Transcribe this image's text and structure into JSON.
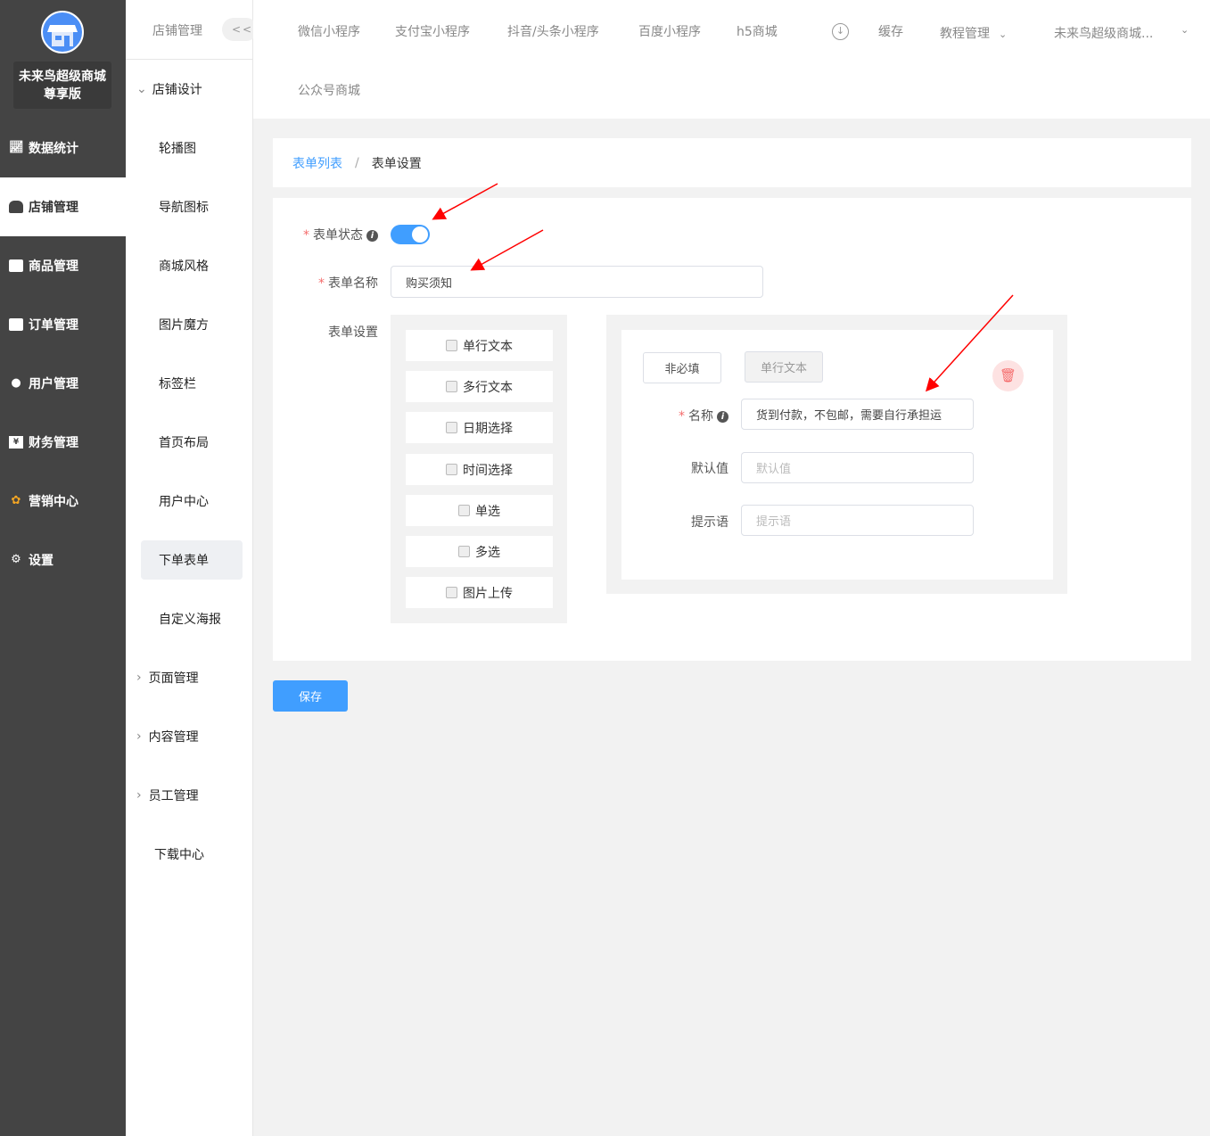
{
  "brand": {
    "name": "未来鸟超级商城尊享版"
  },
  "sidebar": {
    "items": [
      {
        "label": "数据统计",
        "icon": "chart-icon"
      },
      {
        "label": "店铺管理",
        "icon": "shop-icon"
      },
      {
        "label": "商品管理",
        "icon": "goods-icon"
      },
      {
        "label": "订单管理",
        "icon": "order-icon"
      },
      {
        "label": "用户管理",
        "icon": "user-icon"
      },
      {
        "label": "财务管理",
        "icon": "finance-icon"
      },
      {
        "label": "营销中心",
        "icon": "marketing-icon"
      },
      {
        "label": "设置",
        "icon": "settings-icon"
      }
    ]
  },
  "submenu": {
    "title": "店铺管理",
    "collapse": "<<",
    "group": "店铺设计",
    "items": [
      "轮播图",
      "导航图标",
      "商城风格",
      "图片魔方",
      "标签栏",
      "首页布局",
      "用户中心",
      "下单表单",
      "自定义海报"
    ],
    "groups": [
      "页面管理",
      "内容管理",
      "员工管理"
    ],
    "download": "下载中心"
  },
  "topnav": {
    "tabs": [
      "微信小程序",
      "支付宝小程序",
      "抖音/头条小程序",
      "百度小程序",
      "h5商城",
      "公众号商城"
    ],
    "cache": "缓存",
    "tutorial": "教程管理",
    "account": "未来鸟超级商城..."
  },
  "breadcrumb": {
    "parent": "表单列表",
    "sep": "/",
    "current": "表单设置"
  },
  "form": {
    "status_label": "表单状态",
    "status_on": true,
    "name_label": "表单名称",
    "name_value": "购买须知",
    "settings_label": "表单设置"
  },
  "palette": [
    "单行文本",
    "多行文本",
    "日期选择",
    "时间选择",
    "单选",
    "多选",
    "图片上传"
  ],
  "editor": {
    "required_btn": "非必填",
    "type_btn": "单行文本",
    "name_label": "名称",
    "name_value": "货到付款，不包邮，需要自行承担运",
    "default_label": "默认值",
    "default_placeholder": "默认值",
    "hint_label": "提示语",
    "hint_placeholder": "提示语"
  },
  "save": "保存",
  "colors": {
    "primary": "#409eff",
    "sidebar": "#444444",
    "annotation": "#ff0000"
  }
}
